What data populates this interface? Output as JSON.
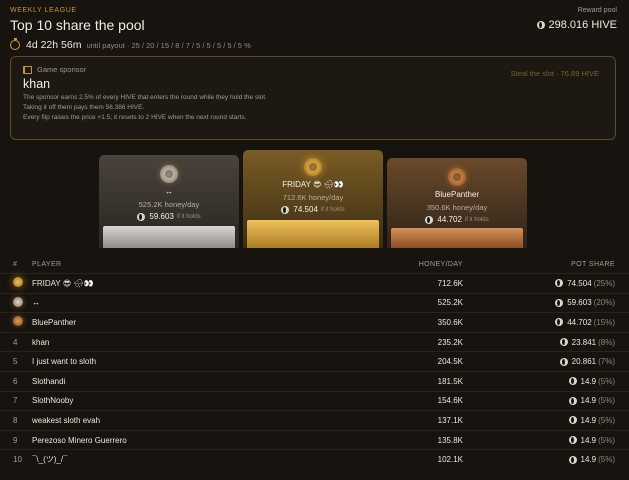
{
  "header": {
    "league_label": "WEEKLY LEAGUE",
    "title": "Top 10 share the pool",
    "countdown": "4d 22h 56m",
    "payout_text": "until payout · 25 / 20 / 15 / 8 / 7 / 5 / 5 / 5 / 5 / 5 %",
    "pool_label": "Reward pool",
    "pool_value": "298.016 HIVE"
  },
  "sponsor": {
    "label": "Game sponsor",
    "name": "khan",
    "steal": "Steal the slot · 76.89 HIVE",
    "lines": [
      "The sponsor earns 2.5% of every HIVE that enters the round while they hold the slot.",
      "Taking it off them pays them 56.386 HIVE.",
      "Every flip raises the price ×1.5; it resets to 2 HIVE when the next round starts."
    ]
  },
  "podium": {
    "first": {
      "name": "FRIDAY 😎 🌧👀",
      "rate": "712.6K honey/day",
      "share": "74.504",
      "hint": "if it holds"
    },
    "second": {
      "name": "↔",
      "rate": "525.2K honey/day",
      "share": "59.603",
      "hint": "if it holds"
    },
    "third": {
      "name": "BluePanther",
      "rate": "350.6K honey/day",
      "share": "44.702",
      "hint": "if it holds"
    }
  },
  "table": {
    "headers": {
      "rank": "#",
      "player": "PLAYER",
      "honey": "HONEY/DAY",
      "share": "POT SHARE"
    },
    "rows": [
      {
        "rank": "",
        "player": "FRIDAY 😎 🌧👀",
        "honey": "712.6K",
        "share": "74.504",
        "pct": "(25%)"
      },
      {
        "rank": "",
        "player": "↔",
        "honey": "525.2K",
        "share": "59.603",
        "pct": "(20%)"
      },
      {
        "rank": "",
        "player": "BluePanther",
        "honey": "350.6K",
        "share": "44.702",
        "pct": "(15%)"
      },
      {
        "rank": "4",
        "player": "khan",
        "honey": "235.2K",
        "share": "23.841",
        "pct": "(8%)"
      },
      {
        "rank": "5",
        "player": "I just want to sloth",
        "honey": "204.5K",
        "share": "20.861",
        "pct": "(7%)"
      },
      {
        "rank": "6",
        "player": "Slothandi",
        "honey": "181.5K",
        "share": "14.9",
        "pct": "(5%)"
      },
      {
        "rank": "7",
        "player": "SlothNooby",
        "honey": "154.6K",
        "share": "14.9",
        "pct": "(5%)"
      },
      {
        "rank": "8",
        "player": "weakest sloth evah",
        "honey": "137.1K",
        "share": "14.9",
        "pct": "(5%)"
      },
      {
        "rank": "9",
        "player": "Perezoso Minero Guerrero",
        "honey": "135.8K",
        "share": "14.9",
        "pct": "(5%)"
      },
      {
        "rank": "10",
        "player": "¯\\_(ツ)_/¯",
        "honey": "102.1K",
        "share": "14.9",
        "pct": "(5%)"
      }
    ]
  },
  "colors": {
    "accent": "#c9952e",
    "gold": "#f1c25a",
    "silver": "#d8d6d2",
    "bronze": "#d5925b"
  },
  "icons": {
    "timer": "timer-icon",
    "coin": "hive-coin-icon",
    "sponsor": "flag-icon",
    "medal": "medal-icon"
  }
}
